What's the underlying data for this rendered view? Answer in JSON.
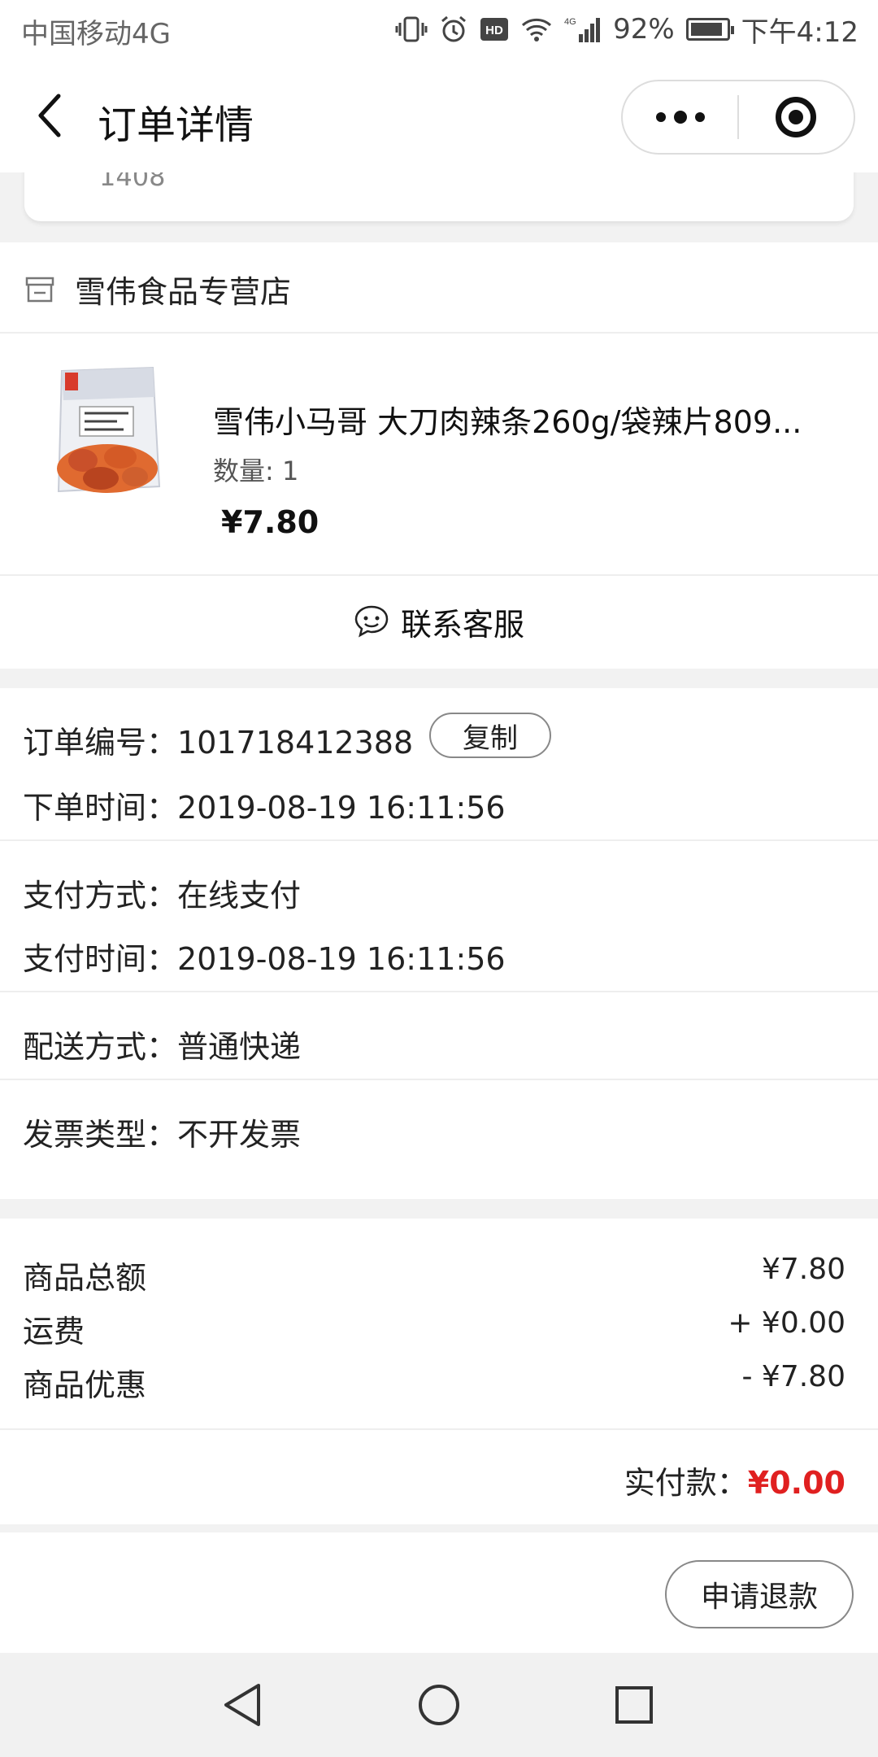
{
  "status_bar": {
    "carrier": "中国移动4G",
    "battery": "92%",
    "time": "下午4:12"
  },
  "nav": {
    "title": "订单详情"
  },
  "address": {
    "partial_text": "1408"
  },
  "store": {
    "name": "雪伟食品专营店"
  },
  "product": {
    "title": "雪伟小马哥 大刀肉辣条260g/袋辣片809...",
    "quantity": "数量: 1",
    "price": "¥7.80"
  },
  "customer_service": {
    "label": "联系客服"
  },
  "order_info": {
    "order_no_label": "订单编号：",
    "order_no": "101718412388",
    "copy_label": "复制",
    "order_time_label": "下单时间：",
    "order_time": "2019-08-19 16:11:56",
    "pay_method_label": "支付方式：",
    "pay_method": "在线支付",
    "pay_time_label": "支付时间：",
    "pay_time": "2019-08-19 16:11:56",
    "delivery_label": "配送方式：",
    "delivery": "普通快递",
    "invoice_label": "发票类型：",
    "invoice": "不开发票"
  },
  "summary": {
    "goods_total_label": "商品总额",
    "goods_total": "¥7.80",
    "shipping_label": "运费",
    "shipping": "+ ¥0.00",
    "discount_label": "商品优惠",
    "discount": "- ¥7.80",
    "paid_label": "实付款：",
    "paid": "¥0.00"
  },
  "actions": {
    "refund_label": "申请退款"
  },
  "colors": {
    "accent_red": "#e02020"
  }
}
